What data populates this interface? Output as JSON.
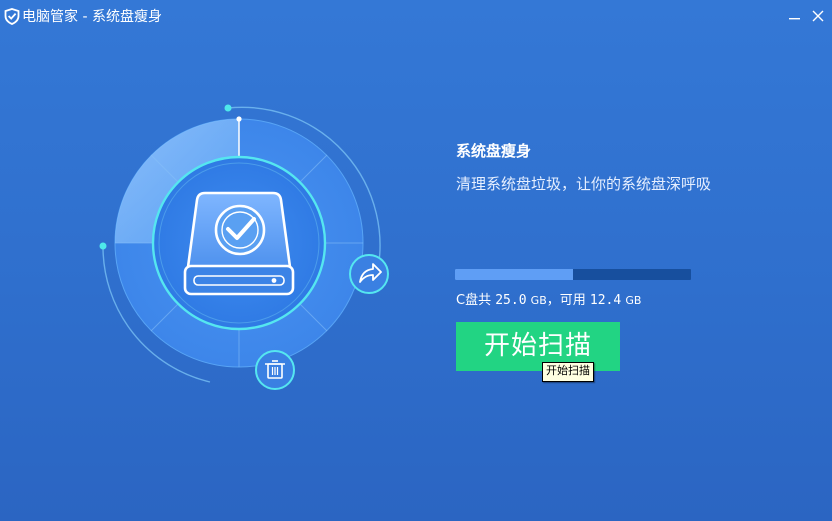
{
  "window": {
    "title": "电脑管家 - 系统盘瘦身",
    "minimize_icon": "minimize-icon",
    "close_icon": "close-icon"
  },
  "feature": {
    "title": "系统盘瘦身",
    "description": "清理系统盘垃圾，让你的系统盘深呼吸"
  },
  "disk": {
    "prefix": "C盘共",
    "total_value": "25.0",
    "total_unit": "GB",
    "separator": "，可用",
    "free_value": "12.4",
    "free_unit": "GB",
    "used_fraction": 0.5
  },
  "scan_button": {
    "label": "开始扫描",
    "tooltip": "开始扫描"
  },
  "illustration": {
    "main_icon": "hard-drive-check-icon",
    "side_icons": [
      "share-arrow-icon",
      "trash-icon"
    ]
  },
  "colors": {
    "background": "#2f6fcd",
    "progress_fill": "#5f9ef5",
    "progress_track": "#174f9e",
    "scan_button": "#22d483",
    "accent_glow": "#55e6f0"
  }
}
